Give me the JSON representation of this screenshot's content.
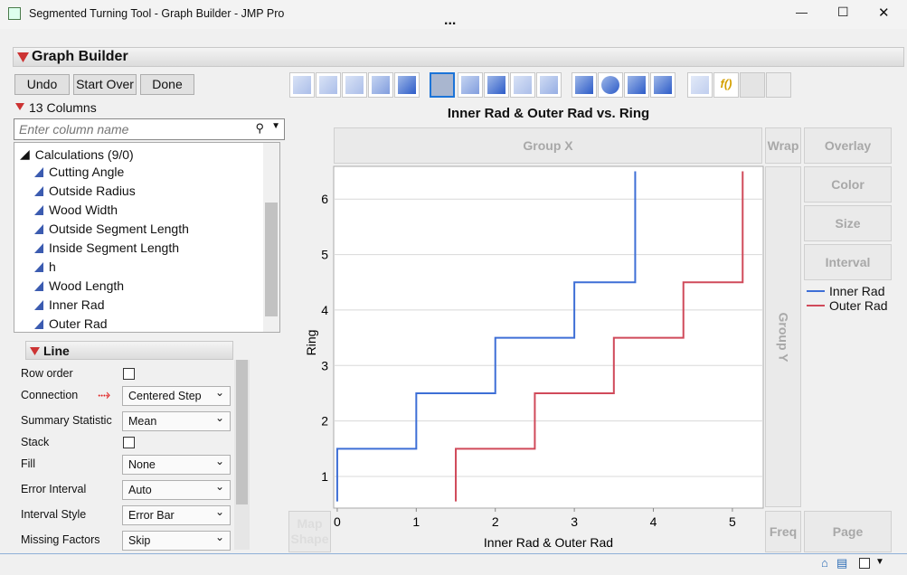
{
  "window": {
    "title": "Segmented Turning Tool - Graph Builder - JMP Pro",
    "minimize": "—",
    "maximize": "☐",
    "close": "✕",
    "more": "..."
  },
  "panel": {
    "title": "Graph Builder",
    "undo": "Undo",
    "start_over": "Start Over",
    "done": "Done",
    "columns_count": "13 Columns",
    "search_placeholder": "Enter column name"
  },
  "columns": {
    "group": "Calculations (9/0)",
    "items": [
      "Cutting Angle",
      "Outside Radius",
      "Wood Width",
      "Outside Segment Length",
      "Inside Segment Length",
      "h",
      "Wood Length",
      "Inner Rad",
      "Outer Rad"
    ]
  },
  "line_panel": {
    "title": "Line",
    "props": [
      {
        "label": "Row order",
        "type": "check"
      },
      {
        "label": "Connection",
        "type": "select",
        "value": "Centered Step"
      },
      {
        "label": "Summary Statistic",
        "type": "select",
        "value": "Mean"
      },
      {
        "label": "Stack",
        "type": "check"
      },
      {
        "label": "Fill",
        "type": "select",
        "value": "None"
      },
      {
        "label": "Error Interval",
        "type": "select",
        "value": "Auto"
      },
      {
        "label": "Interval Style",
        "type": "select",
        "value": "Error Bar"
      },
      {
        "label": "Missing Factors",
        "type": "select",
        "value": "Skip"
      }
    ]
  },
  "zones": {
    "group_x": "Group X",
    "wrap": "Wrap",
    "overlay": "Overlay",
    "color": "Color",
    "size": "Size",
    "interval": "Interval",
    "group_y": "Group Y",
    "freq": "Freq",
    "page": "Page",
    "map_shape": "Map Shape"
  },
  "colors": {
    "inner": "#3e6fd6",
    "outer": "#d04a5a"
  },
  "chart_data": {
    "type": "line",
    "title": "Inner Rad & Outer Rad vs. Ring",
    "xlabel": "Inner Rad & Outer Rad",
    "ylabel": "Ring",
    "connection": "centered step",
    "y": [
      1,
      2,
      3,
      4,
      5,
      6
    ],
    "series": [
      {
        "name": "Inner Rad",
        "values": [
          0,
          1,
          2,
          3,
          3.77,
          3.77
        ]
      },
      {
        "name": "Outer Rad",
        "values": [
          1.5,
          2.5,
          3.5,
          4.38,
          5.13,
          5.13
        ]
      }
    ],
    "xlim": [
      -0.045,
      5.39
    ],
    "ylim": [
      0.43,
      6.59
    ],
    "xticks": [
      0,
      1,
      2,
      3,
      4,
      5
    ],
    "yticks": [
      1,
      2,
      3,
      4,
      5,
      6
    ],
    "grid": "horizontal",
    "legend": "right"
  }
}
